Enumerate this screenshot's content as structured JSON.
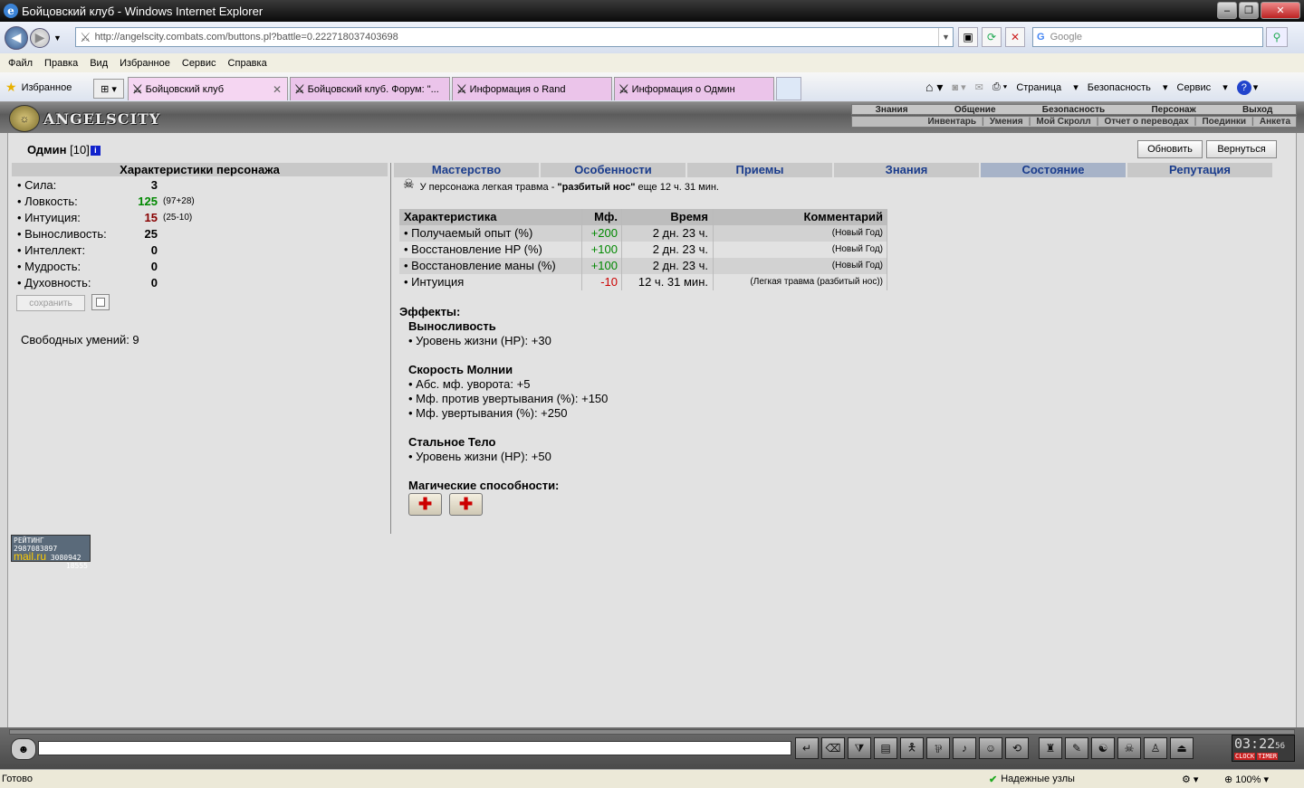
{
  "window": {
    "title": "Бойцовский клуб - Windows Internet Explorer"
  },
  "nav": {
    "url": "http://angelscity.combats.com/buttons.pl?battle=0.222718037403698",
    "search_placeholder": "Google"
  },
  "menu": [
    "Файл",
    "Правка",
    "Вид",
    "Избранное",
    "Сервис",
    "Справка"
  ],
  "favorites": "Избранное",
  "tabs": [
    "Бойцовский клуб",
    "Бойцовский клуб. Форум: \"...",
    "Информация о Rand",
    "Информация о Одмин"
  ],
  "commands": [
    "Страница",
    "Безопасность",
    "Сервис"
  ],
  "game": {
    "logo": "ANGELSCITY",
    "top_menu": [
      "Знания",
      "Общение",
      "Безопасность",
      "Персонаж",
      "Выход"
    ],
    "sub_menu": [
      "Инвентарь",
      "Умения",
      "Мой Скролл",
      "Отчет о переводах",
      "Поединки",
      "Анкета"
    ],
    "char_name": "Одмин",
    "char_level": "[10]",
    "buttons": {
      "refresh": "Обновить",
      "back": "Вернуться",
      "save": "сохранить"
    },
    "stats_title": "Характеристики персонажа",
    "stats": [
      {
        "name": "• Сила:",
        "value": "3",
        "extra": ""
      },
      {
        "name": "• Ловкость:",
        "value": "125",
        "extra": "(97+28)",
        "color": "#008000"
      },
      {
        "name": "• Интуиция:",
        "value": "15",
        "extra": "(25-10)",
        "color": "#880000"
      },
      {
        "name": "• Выносливость:",
        "value": "25",
        "extra": ""
      },
      {
        "name": "• Интеллект:",
        "value": "0",
        "extra": ""
      },
      {
        "name": "• Мудрость:",
        "value": "0",
        "extra": ""
      },
      {
        "name": "• Духовность:",
        "value": "0",
        "extra": ""
      }
    ],
    "free_skills": "Свободных умений: 9",
    "section_tabs": [
      "Мастерство",
      "Особенности",
      "Приемы",
      "Знания",
      "Состояние",
      "Репутация"
    ],
    "injury": {
      "before": "У персонажа легкая травма -",
      "name": "\"разбитый нос\"",
      "after": "еще 12 ч. 31 мин."
    },
    "table_headers": [
      "Характеристика",
      "Мф.",
      "Время",
      "Комментарий"
    ],
    "table_rows": [
      [
        "• Получаемый опыт (%)",
        "+200",
        "2 дн. 23 ч.",
        "(Новый Год)"
      ],
      [
        "• Восстановление HP (%)",
        "+100",
        "2 дн. 23 ч.",
        "(Новый Год)"
      ],
      [
        "• Восстановление маны (%)",
        "+100",
        "2 дн. 23 ч.",
        "(Новый Год)"
      ],
      [
        "• Интуиция",
        "-10",
        "12 ч. 31 мин.",
        "(Легкая травма (разбитый нос))"
      ]
    ],
    "effects_title": "Эффекты:",
    "effects": [
      {
        "name": "Выносливость",
        "items": [
          "• Уровень жизни (HP): +30"
        ]
      },
      {
        "name": "Скорость Молнии",
        "items": [
          "• Абс. мф. уворота: +5",
          "• Мф. против увертывания (%): +150",
          "• Мф. увертывания (%): +250"
        ]
      },
      {
        "name": "Стальное Тело",
        "items": [
          "• Уровень жизни (HP): +50"
        ]
      }
    ],
    "magic_title": "Магические способности:",
    "counter": {
      "label": "РЕЙТИНГ",
      "n1": "2987083897",
      "brand": "mail.ru",
      "n2": "3080942",
      "n3": "18555"
    },
    "clock": {
      "time": "03:22",
      "sec": "56",
      "clock_label": "CLOCK",
      "timer_label": "TIMER"
    }
  },
  "status": {
    "left": "Готово",
    "secure": "Надежные узлы",
    "zoom": "100%"
  }
}
